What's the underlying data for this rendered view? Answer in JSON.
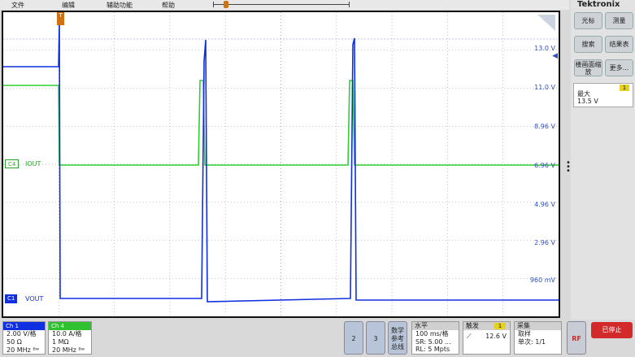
{
  "menu": {
    "file": "文件",
    "edit": "编辑",
    "utility": "辅助功能",
    "help": "帮助"
  },
  "brand": "Tektronix",
  "trigger_marker": "T",
  "vertical_scale": [
    "13.0 V",
    "11.0 V",
    "8.96 V",
    "6.96 V",
    "4.96 V",
    "2.96 V",
    "960 mV"
  ],
  "channels_on_screen": {
    "c4_tag": "C4",
    "c4_name": "IOUT",
    "c1_tag": "C1",
    "c1_name": "VOUT"
  },
  "side_buttons": {
    "cursor": "光标",
    "measure": "测量",
    "search": "搜索",
    "results_table": "结果表",
    "zoom": "楼画面缩放",
    "more": "更多..."
  },
  "measurement": {
    "badge": "1",
    "name": "最大",
    "value": "13.5 V"
  },
  "ch1": {
    "header": "Ch 1",
    "scale": "2.00 V/格",
    "impedance": "50 Ω",
    "bandwidth": "20 MHz ᴮʷ"
  },
  "ch4": {
    "header": "Ch 4",
    "scale": "10.0 A/格",
    "impedance": "1 MΩ",
    "bandwidth": "20 MHz ᴮʷ"
  },
  "math_buttons": {
    "b2": "2",
    "b3": "3",
    "math": "数学\n参考\n总线"
  },
  "horizontal": {
    "header": "水平",
    "scale": "100 ms/格",
    "sr": "SR: 5.00 ...",
    "rl": "RL: 5 Mpts"
  },
  "trigger": {
    "header": "触发",
    "badge": "1",
    "level": "12.6 V"
  },
  "acquire": {
    "header": "采集",
    "mode": "取样",
    "count": "单次: 1/1"
  },
  "rf": "RF",
  "run_state": "已停止",
  "colors": {
    "ch1": "#1030e0",
    "ch4": "#30d030",
    "trigger": "#d07010",
    "stop": "#d22a2a"
  }
}
